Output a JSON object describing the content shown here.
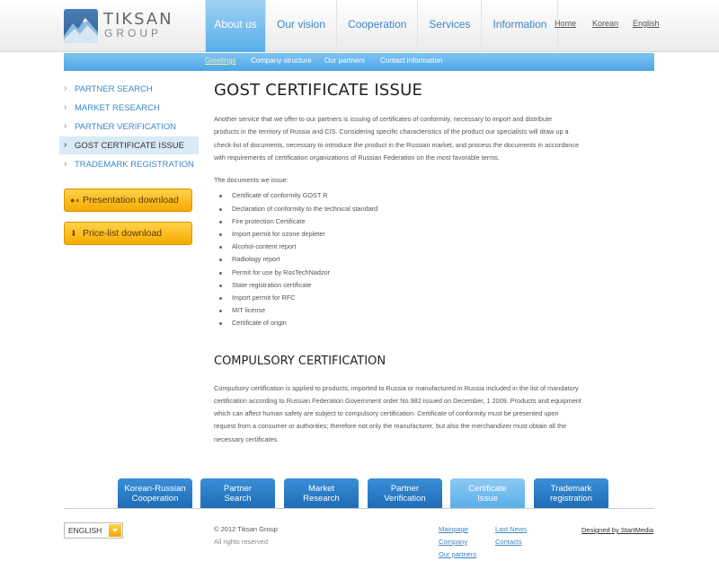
{
  "logo": {
    "line1": "TIKSAN",
    "line2": "GROUP"
  },
  "mainnav": [
    {
      "label": "About us",
      "active": true
    },
    {
      "label": "Our vision"
    },
    {
      "label": "Cooperation"
    },
    {
      "label": "Services"
    },
    {
      "label": "Information"
    }
  ],
  "toplinks": {
    "home": "Home",
    "korean": "Korean",
    "english": "English"
  },
  "subnav": {
    "greetings": "Greetings",
    "structure": "Company structure",
    "partners": "Our partners",
    "contact": "Contact information"
  },
  "sidebar": {
    "items": [
      {
        "label": "PARTNER SEARCH"
      },
      {
        "label": "MARKET RESEARCH"
      },
      {
        "label": "PARTNER VERIFICATION"
      },
      {
        "label": "GOST CERTIFICATE ISSUE",
        "active": true
      },
      {
        "label": "TRADEMARK REGISTRATION"
      }
    ],
    "presentation_btn": "Presentation download",
    "pricelist_btn": "Price-list download"
  },
  "main": {
    "title": "GOST CERTIFICATE ISSUE",
    "intro_lines": [
      "Another service that we offer to our partners is issuing of certificates of conformity, necessary to import and distribute",
      "products in the territory of Russia and CIS. Considering specific characteristics of the product our specialists will draw up a",
      "check-list of documents, necessary to introduce the product in the Russian market, and process the documents in accordance",
      "with requirements of certification organizations of Russian Federation on the most favorable terms."
    ],
    "docs_intro": "The documents we issue:",
    "docs": [
      "Certificate of conformity GOST R",
      "Declaration of conformity to the technical standard",
      "Fire protection Certificate",
      "Import permit for ozone depleter",
      "Alcohol-content report",
      "Radiology report",
      "Permit for use by RosTechNadzor",
      "State registration certificate",
      "Import permit for RFC",
      "MIT license",
      "Certificate of origin"
    ],
    "subtitle": "COMPULSORY CERTIFICATION",
    "compulsory_lines": [
      "Compulsory certification is applied to products, imported to Russia or manufactured in Russia included in the list of mandatory",
      "certification according to Russian Federation Government order No.982 issued on December, 1 2009. Products and equipment",
      "which can affect human safety are subject to compulsory certification. Certificate of conformity must be presented upon",
      "request from a consumer or authorities; therefore not only the manufacturer, but also the merchandizer must obtain all the",
      "necessary certificates."
    ]
  },
  "bottom_tabs": [
    {
      "l1": "Korean-Russian",
      "l2": "Cooperation"
    },
    {
      "l1": "Partner",
      "l2": "Search"
    },
    {
      "l1": "Market",
      "l2": "Research"
    },
    {
      "l1": "Partner",
      "l2": "Verification"
    },
    {
      "l1": "Certificate",
      "l2": "Issue",
      "active": true
    },
    {
      "l1": "Trademark",
      "l2": "registration"
    }
  ],
  "footer": {
    "language": "ENGLISH",
    "copyright": "© 2012 Tiksan Group",
    "rights": "All rights reserved",
    "links": {
      "mainpage": "Mainpage",
      "company": "Company",
      "partners": "Our partners",
      "news": "Last News",
      "contacts": "Contacts"
    },
    "designed": "Designed by StartMedia"
  },
  "colors": {
    "link": "#3a86c8",
    "accent_blue": "#57aee8",
    "button_orange": "#f7a900"
  }
}
